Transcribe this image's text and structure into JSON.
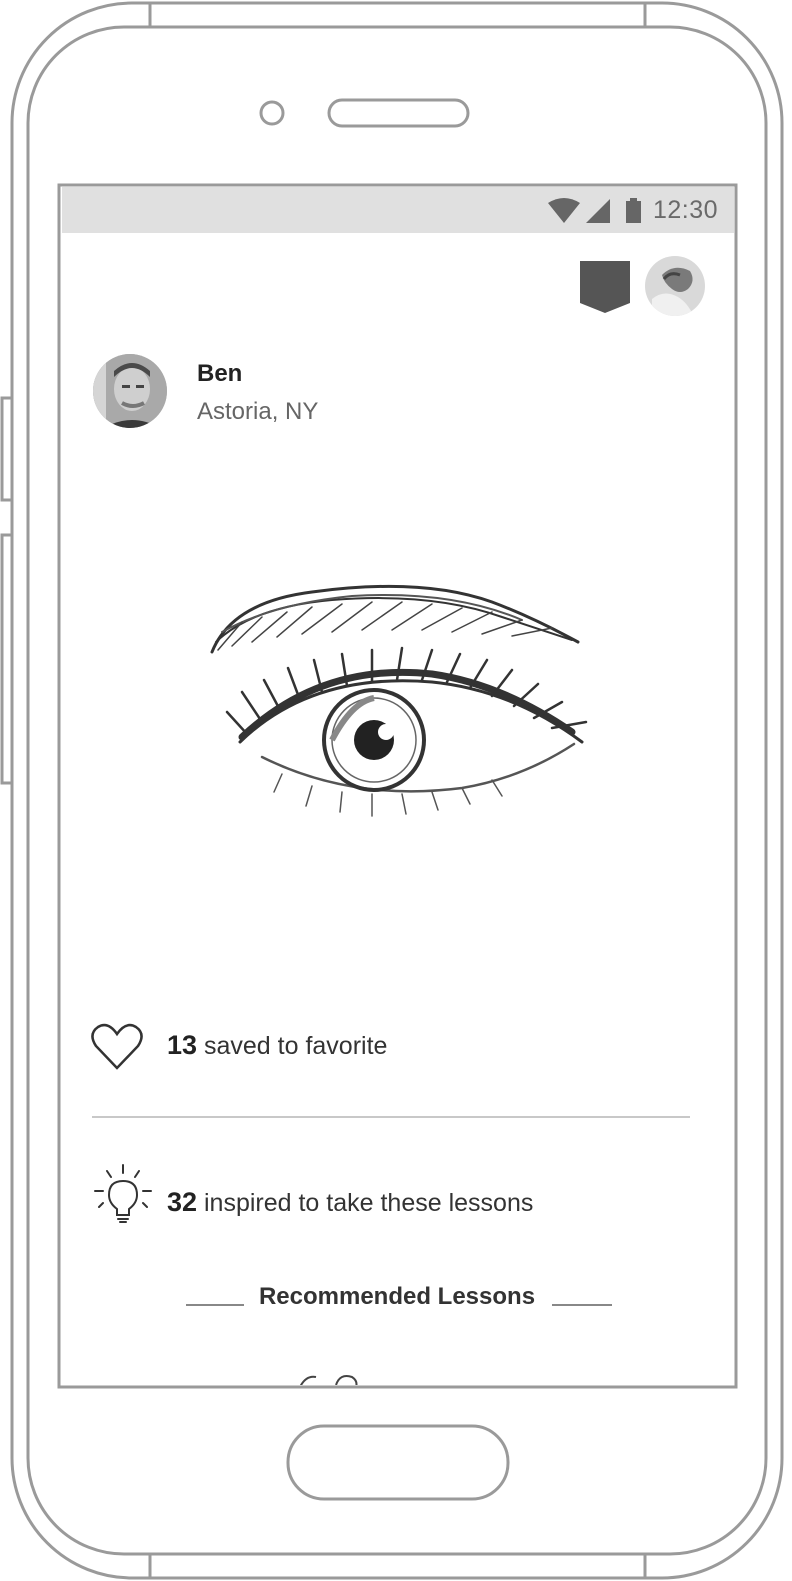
{
  "status_bar": {
    "time": "12:30",
    "icons": [
      "wifi-icon",
      "signal-icon",
      "battery-icon"
    ]
  },
  "header": {
    "actions": [
      "bookmark-icon",
      "user-avatar"
    ]
  },
  "profile": {
    "name": "Ben",
    "location": "Astoria, NY"
  },
  "artwork": {
    "subject": "eye-sketch"
  },
  "stats": {
    "favorites_count": "13",
    "favorites_label": " saved to favorite",
    "inspired_count": "32",
    "inspired_label": " inspired to take these lessons"
  },
  "recommended": {
    "title": "Recommended Lessons"
  },
  "colors": {
    "device_outline": "#9a9a9a",
    "status_bar_bg": "#e0e0e0",
    "bookmark": "#555555",
    "divider": "#c8c8c8"
  }
}
